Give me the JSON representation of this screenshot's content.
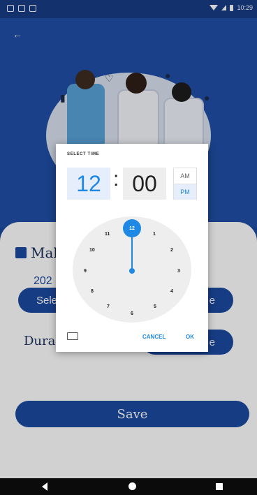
{
  "status": {
    "time": "10:29"
  },
  "screen": {
    "title_partial": "Mak",
    "year_partial": "202",
    "select_date_partial": "Sele",
    "select_time_partial": "e",
    "duration_partial": "Durat",
    "duration_button_partial": "e",
    "save_label": "Save"
  },
  "time_picker": {
    "title": "SELECT TIME",
    "hour": "12",
    "colon": ":",
    "minute": "00",
    "am": "AM",
    "pm": "PM",
    "selected_period": "PM",
    "selected_hour": "12",
    "clock_numbers": [
      "12",
      "1",
      "2",
      "3",
      "4",
      "5",
      "6",
      "7",
      "8",
      "9",
      "10",
      "11"
    ],
    "cancel_label": "CANCEL",
    "ok_label": "OK"
  },
  "colors": {
    "primary": "#1b4aa0",
    "accent": "#1e88e5"
  },
  "icons": [
    "back-arrow-icon",
    "calendar-icon",
    "keyboard-icon",
    "wifi-icon",
    "signal-icon",
    "battery-icon"
  ]
}
